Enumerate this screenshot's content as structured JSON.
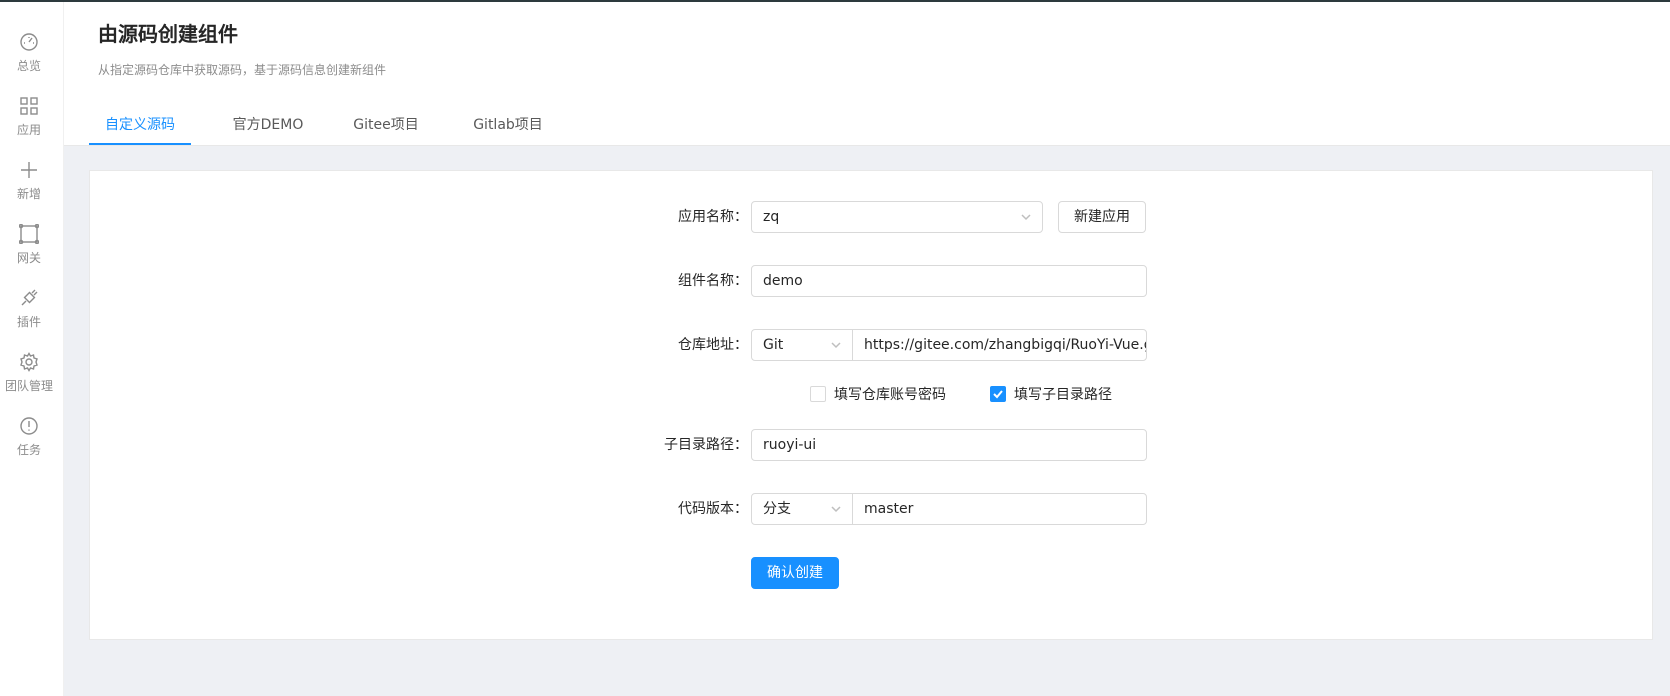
{
  "sidebar": {
    "items": [
      {
        "label": "总览",
        "icon": "dashboard-icon"
      },
      {
        "label": "应用",
        "icon": "apps-grid-icon"
      },
      {
        "label": "新增",
        "icon": "plus-icon"
      },
      {
        "label": "网关",
        "icon": "gateway-icon"
      },
      {
        "label": "插件",
        "icon": "plugin-icon"
      },
      {
        "label": "团队管理",
        "icon": "gear-icon"
      },
      {
        "label": "任务",
        "icon": "alert-circle-icon"
      }
    ]
  },
  "header": {
    "title": "由源码创建组件",
    "subtitle": "从指定源码仓库中获取源码，基于源码信息创建新组件"
  },
  "tabs": [
    {
      "label": "自定义源码",
      "active": true
    },
    {
      "label": "官方DEMO",
      "active": false
    },
    {
      "label": "Gitee项目",
      "active": false
    },
    {
      "label": "Gitlab项目",
      "active": false
    }
  ],
  "form": {
    "app_name": {
      "label": "应用名称：",
      "value": "zq",
      "new_button": "新建应用"
    },
    "component_name": {
      "label": "组件名称：",
      "value": "demo"
    },
    "repo": {
      "label": "仓库地址：",
      "type": "Git",
      "url": "https://gitee.com/zhangbigqi/RuoYi-Vue.gi"
    },
    "options": {
      "account_label": "填写仓库账号密码",
      "account_checked": false,
      "subdir_label": "填写子目录路径",
      "subdir_checked": true
    },
    "subdir": {
      "label": "子目录路径：",
      "value": "ruoyi-ui"
    },
    "version": {
      "label": "代码版本：",
      "type": "分支",
      "value": "master"
    },
    "submit": "确认创建"
  },
  "colors": {
    "primary": "#1890ff",
    "background": "#eef0f4"
  }
}
